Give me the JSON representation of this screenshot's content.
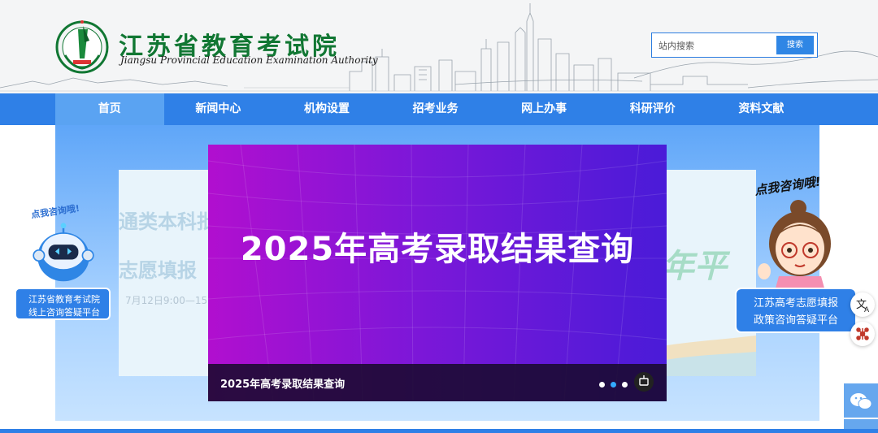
{
  "header": {
    "title_cn": "江苏省教育考试院",
    "title_en": "Jiangsu Provincial Education Examination Authority",
    "logo_icon": "exam-authority-emblem",
    "search": {
      "placeholder": "站内搜索",
      "button_label": "搜索"
    }
  },
  "nav": {
    "items": [
      "首页",
      "新闻中心",
      "机构设置",
      "招考业务",
      "网上办事",
      "科研评价",
      "资料文献"
    ],
    "active": "首页"
  },
  "carousel": {
    "headline": "2025年高考录取结果查询",
    "caption": "2025年高考录取结果查询",
    "dots_count": 3,
    "active_dot": 2,
    "background_behind": {
      "line1": "通类本科批",
      "line2": "志愿填报",
      "line3": "7月12日9:00—15:",
      "line4": "年平"
    }
  },
  "robot_widget": {
    "bubble": "点我咨询哦!",
    "line1": "江苏省教育考试院",
    "line2": "线上咨询答疑平台"
  },
  "girl_widget": {
    "bubble": "点我咨询哦!",
    "line1": "江苏高考志愿填报",
    "line2": "政策咨询答疑平台"
  },
  "side_tools": {
    "translate_icon": "translate-icon",
    "accessibility_icon": "network-icon",
    "wechat_icon": "wechat-icon"
  },
  "colors": {
    "brand_green": "#117733",
    "nav_blue": "#2f80e7",
    "nav_active": "#5aa3f2",
    "slide_purple": "#7d17d8"
  }
}
